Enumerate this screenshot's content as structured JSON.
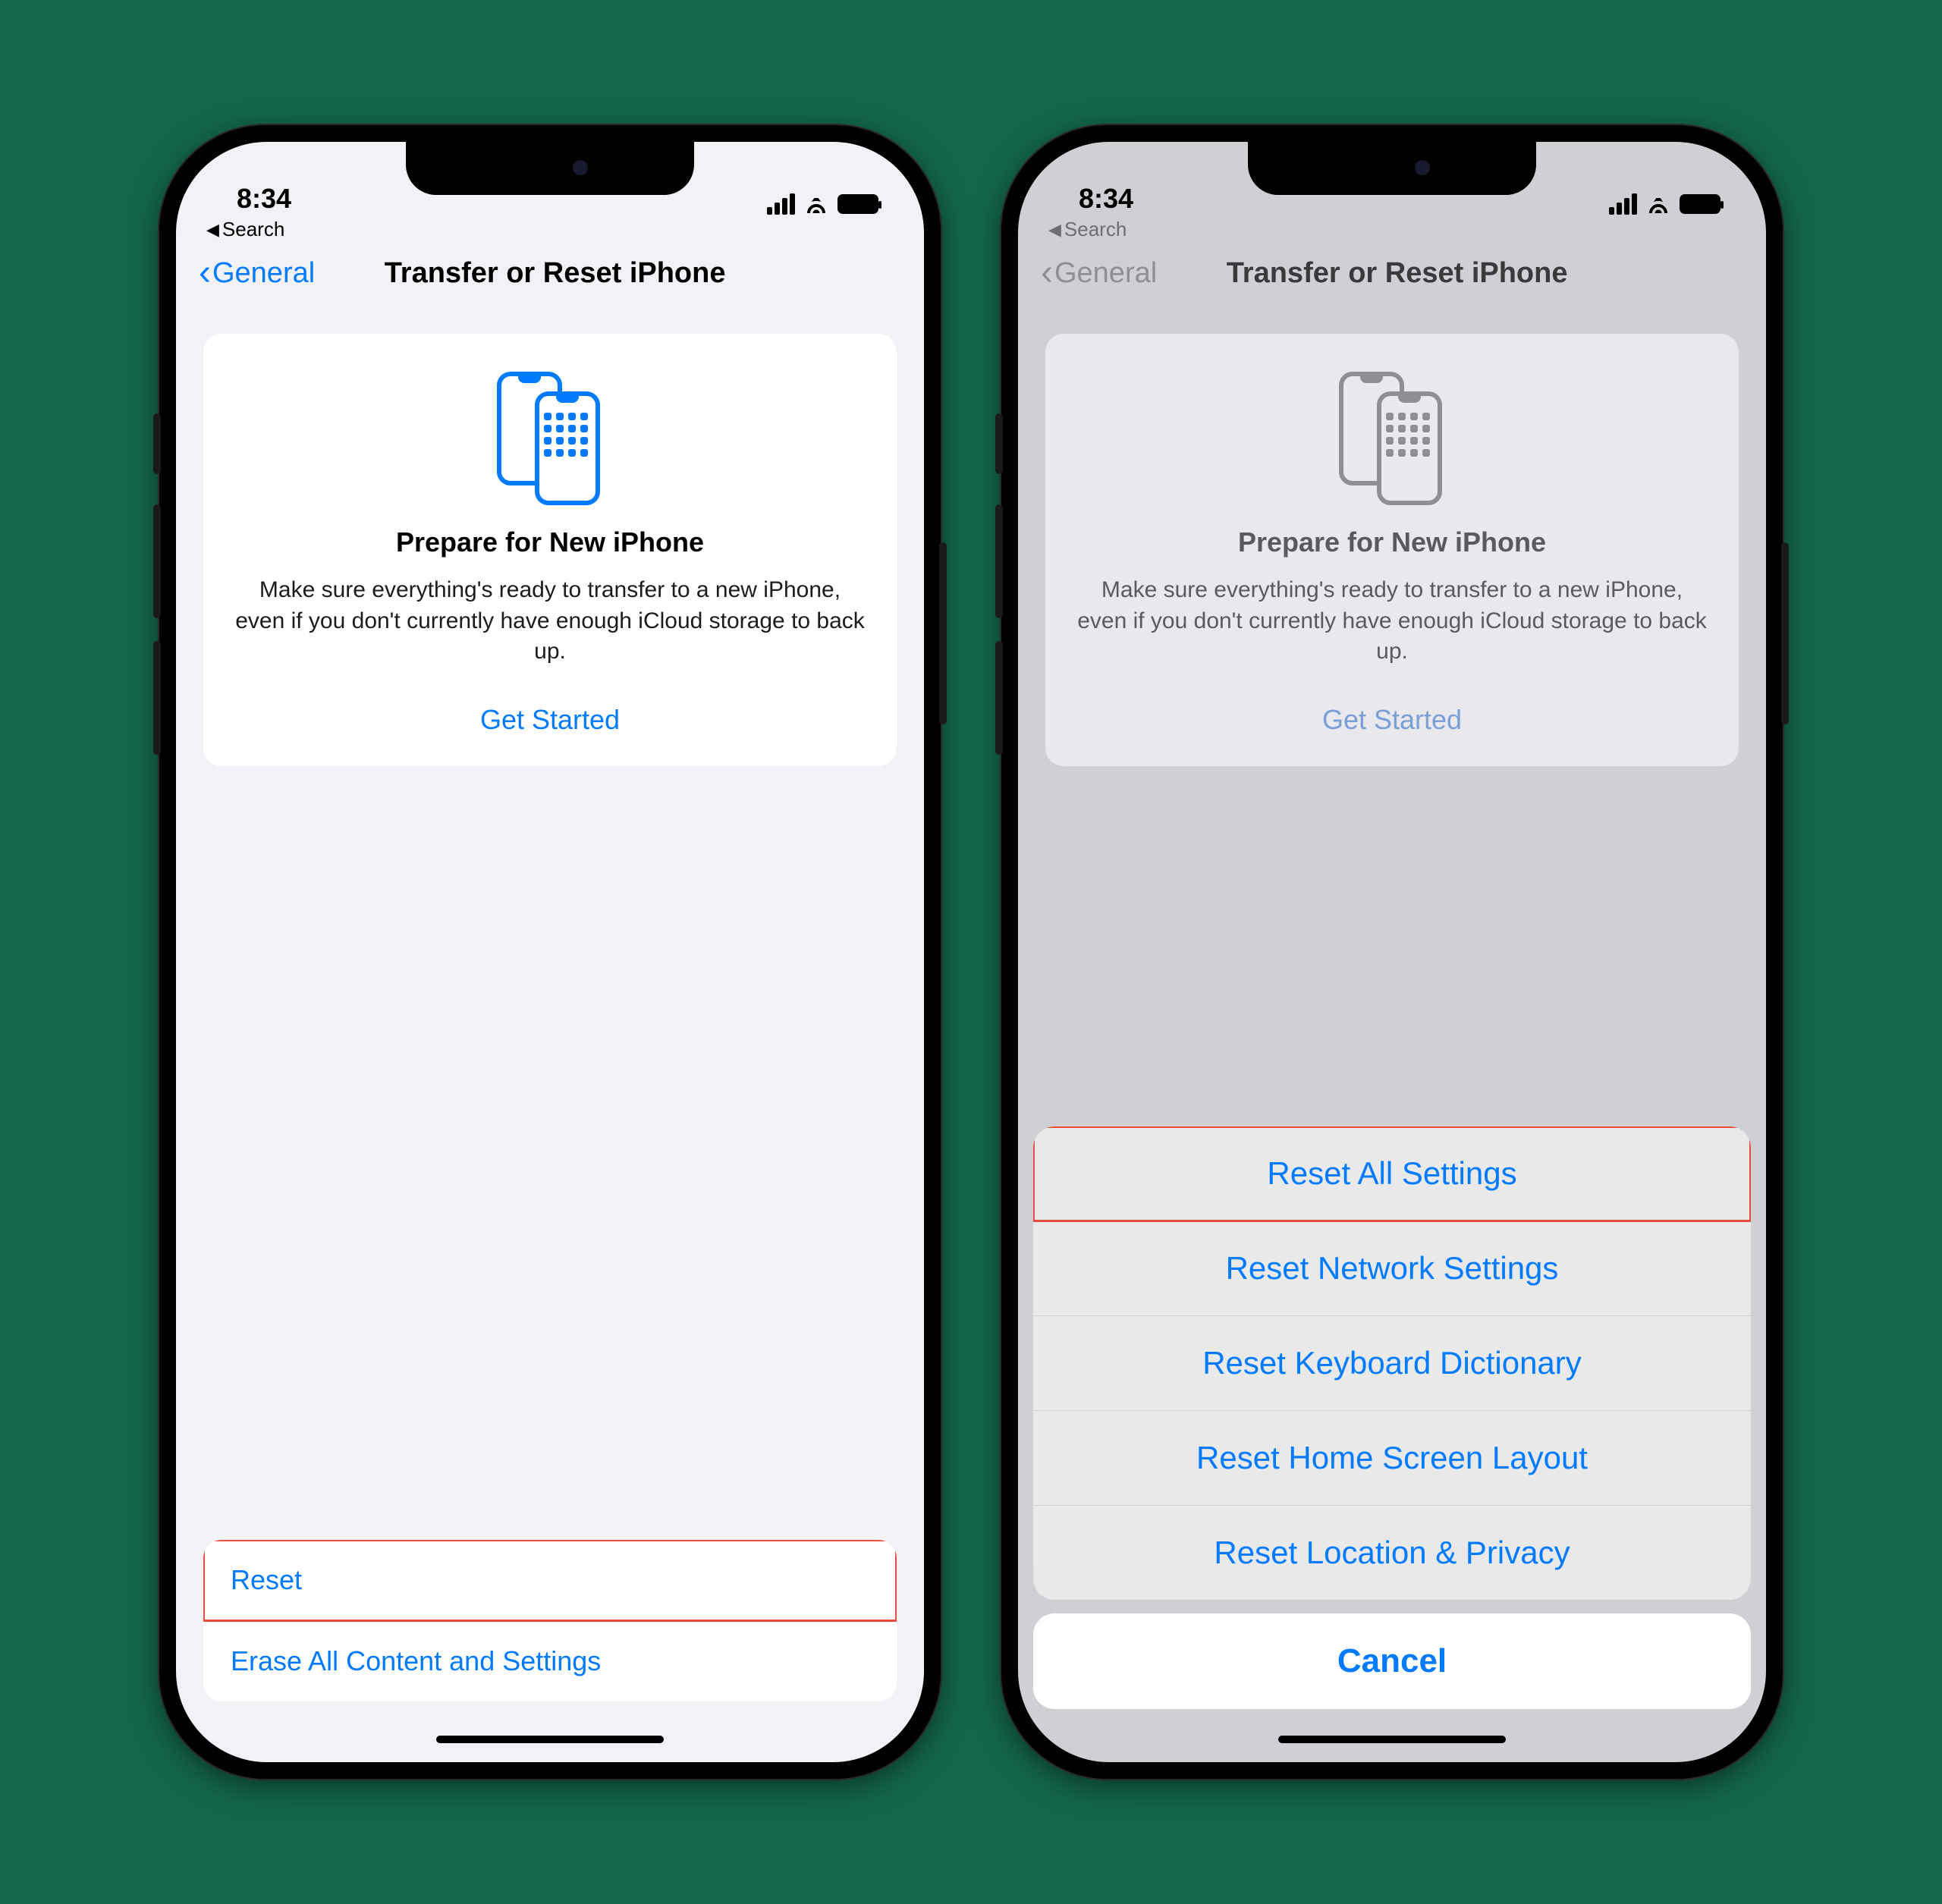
{
  "status": {
    "time": "8:34"
  },
  "breadcrumb": {
    "back_to": "Search"
  },
  "nav": {
    "back": "General",
    "title": "Transfer or Reset iPhone"
  },
  "card": {
    "heading": "Prepare for New iPhone",
    "body": "Make sure everything's ready to transfer to a new iPhone, even if you don't currently have enough iCloud storage to back up.",
    "cta": "Get Started"
  },
  "bottom_rows": {
    "reset": "Reset",
    "erase": "Erase All Content and Settings"
  },
  "action_sheet": {
    "options": [
      "Reset All Settings",
      "Reset Network Settings",
      "Reset Keyboard Dictionary",
      "Reset Home Screen Layout",
      "Reset Location & Privacy"
    ],
    "cancel": "Cancel"
  },
  "colors": {
    "accent": "#007aff",
    "icon_grey": "#8e8e93"
  }
}
